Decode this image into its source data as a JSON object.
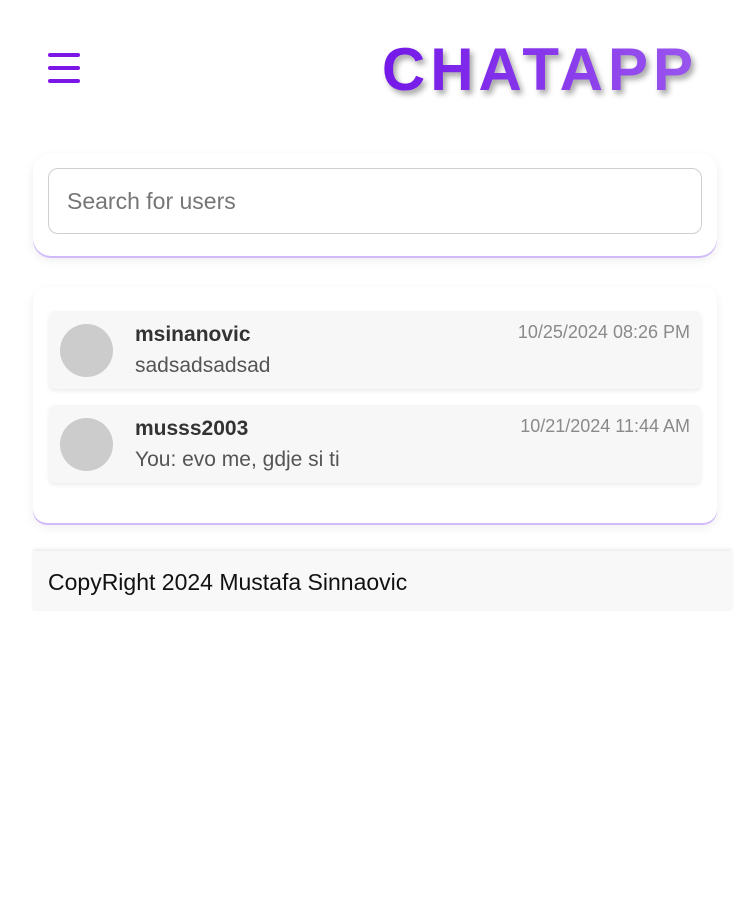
{
  "header": {
    "brand": "CHATAPP",
    "menu_icon": "hamburger-menu-icon"
  },
  "search": {
    "placeholder": "Search for users",
    "value": ""
  },
  "conversations": [
    {
      "username": "msinanovic",
      "last_message": "sadsadsadsad",
      "timestamp": "10/25/2024 08:26 PM"
    },
    {
      "username": "musss2003",
      "last_message": "You: evo me, gdje si ti",
      "timestamp": "10/21/2024 11:44 AM"
    }
  ],
  "footer": {
    "text": "CopyRight 2024 Mustafa Sinnaovic"
  },
  "colors": {
    "accent": "#7a16e6",
    "avatar_placeholder": "#cccccc"
  }
}
